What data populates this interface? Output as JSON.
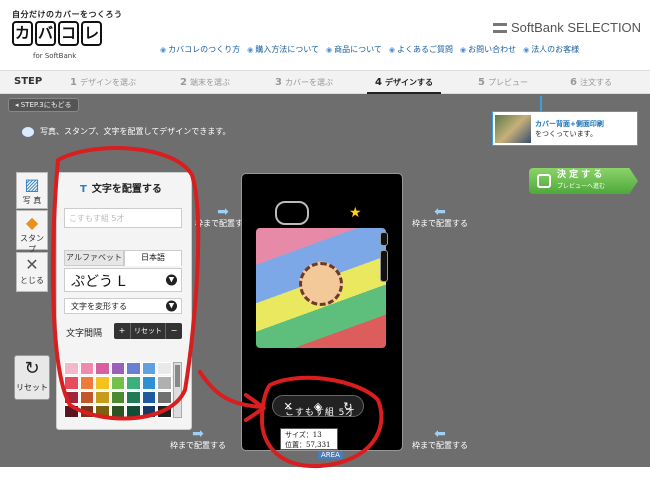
{
  "header": {
    "tagline": "自分だけのカバーをつくろう",
    "logo_chars": [
      "カ",
      "バ",
      "コ",
      "レ"
    ],
    "logo_sub": "for SoftBank",
    "brand": "SoftBank SELECTION",
    "nav": [
      "カバコレのつくり方",
      "購入方法について",
      "商品について",
      "よくあるご質問",
      "お問い合わせ",
      "法人のお客様"
    ]
  },
  "steps": {
    "title": "STEP",
    "items": [
      {
        "num": "1",
        "label": "デザインを選ぶ"
      },
      {
        "num": "2",
        "label": "端末を選ぶ"
      },
      {
        "num": "3",
        "label": "カバーを選ぶ"
      },
      {
        "num": "4",
        "label": "デザインする"
      },
      {
        "num": "5",
        "label": "プレビュー"
      },
      {
        "num": "6",
        "label": "注文する"
      }
    ],
    "active_index": 3
  },
  "stage": {
    "back_label": "◂ STEP.3にもどる",
    "instruction": "写真、スタンプ、文字を配置してデザインできます。",
    "promo_title": "カバー背面+側面印刷",
    "promo_sub": "をつくっています。",
    "decide_label": "決 定 す る",
    "decide_sub": "プレビューへ進む"
  },
  "tools": {
    "photo": "写 真",
    "stamp": "スタンプ",
    "close": "とじる",
    "reset": "リセット"
  },
  "text_panel": {
    "title": "文字を配置する",
    "input_placeholder": "こすもす組 5才",
    "tab_alpha": "アルファベット",
    "tab_ja": "日本語",
    "font_value": "ぷどう L",
    "transform_label": "文字を変形する",
    "spacing_label": "文字間隔",
    "spacing_plus": "+",
    "spacing_reset": "リセット",
    "spacing_minus": "−",
    "palette": [
      "#f5b8c8",
      "#ee8ab0",
      "#d75fa1",
      "#9a5fb8",
      "#6b7fd1",
      "#5fa0e0",
      "#e9e9e9",
      "#e84b5c",
      "#f07a3a",
      "#f4c21f",
      "#73c04a",
      "#3bb07d",
      "#2f8fd3",
      "#b0b0b0",
      "#a3233a",
      "#c2552a",
      "#c79a17",
      "#4a8a31",
      "#1f7a57",
      "#1f5a9e",
      "#707070",
      "#5a1420",
      "#7a3317",
      "#7d610c",
      "#2b5520",
      "#124d37",
      "#153a66",
      "#202020"
    ]
  },
  "phone": {
    "edit_text": "こすもす組 5才",
    "size_label": "サイズ：13",
    "position_label": "位置：57,331",
    "area_label": "AREA"
  },
  "guides": {
    "text": "枠まで配置する"
  }
}
